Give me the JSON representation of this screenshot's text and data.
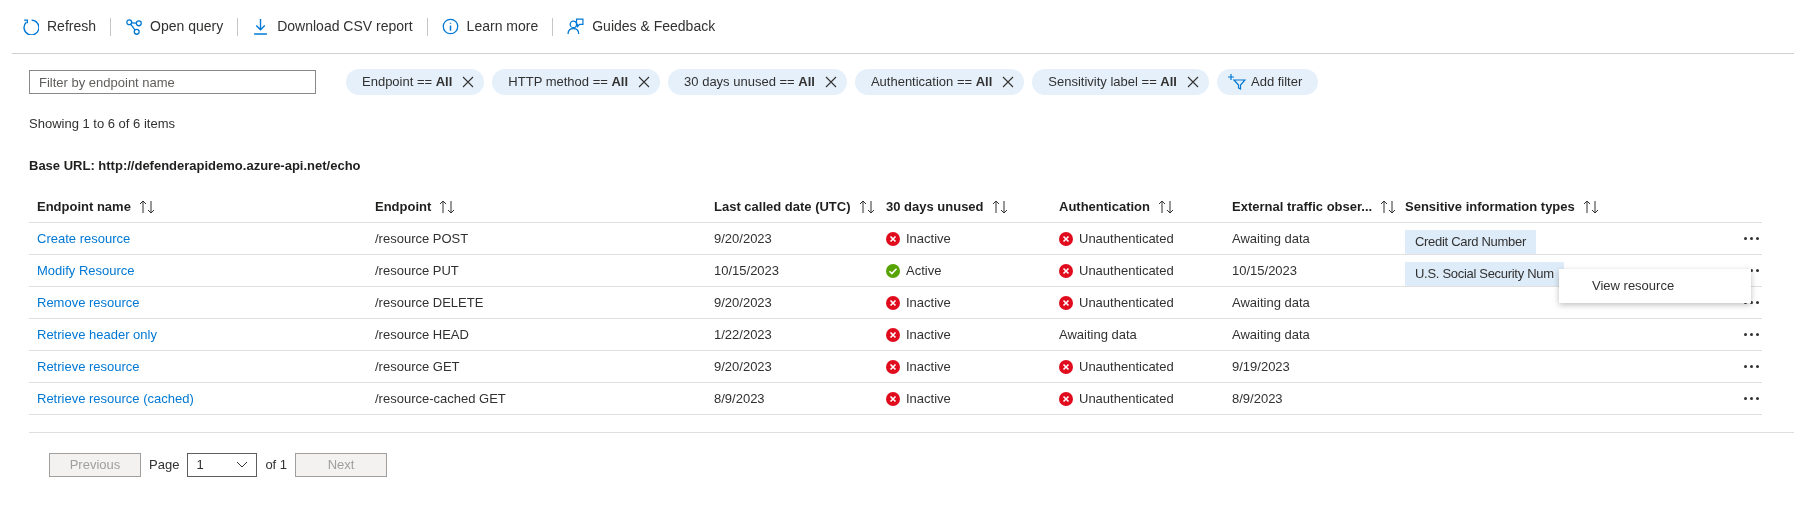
{
  "toolbar": [
    {
      "kind": "refresh",
      "label": "Refresh"
    },
    {
      "kind": "query",
      "label": "Open query"
    },
    {
      "kind": "download",
      "label": "Download CSV report"
    },
    {
      "kind": "info",
      "label": "Learn more"
    },
    {
      "kind": "feedback",
      "label": "Guides & Feedback"
    }
  ],
  "search": {
    "placeholder": "Filter by endpoint name"
  },
  "filters": [
    {
      "label": "Endpoint == **All**"
    },
    {
      "label": "HTTP method == **All**"
    },
    {
      "label": "30 days unused == **All**"
    },
    {
      "label": "Authentication == **All**"
    },
    {
      "label": "Sensitivity label == **All**"
    }
  ],
  "add_filter": "Add filter",
  "summary": "Showing 1 to 6 of 6 items",
  "base_url": "Base URL: http://defenderapidemo.azure-api.net/echo",
  "table": {
    "columns": [
      "Endpoint name",
      "Endpoint",
      "Last called date (UTC)",
      "30 days unused",
      "Authentication",
      "External traffic obser...",
      "Sensitive information types"
    ],
    "rows": [
      {
        "name": "Create resource",
        "endpoint": "/resource POST",
        "last_called": "9/20/2023",
        "unused": {
          "kind": "inactive",
          "text": "Inactive"
        },
        "auth": {
          "kind": "unauthenticated",
          "text": "Unauthenticated"
        },
        "external": "Awaiting data",
        "sensitive": [
          "Credit Card Number"
        ]
      },
      {
        "name": "Modify Resource",
        "endpoint": "/resource PUT",
        "last_called": "10/15/2023",
        "unused": {
          "kind": "active",
          "text": "Active"
        },
        "auth": {
          "kind": "unauthenticated",
          "text": "Unauthenticated"
        },
        "external": "10/15/2023",
        "sensitive": [
          "U.S. Social Security Num"
        ],
        "menu_open": true
      },
      {
        "name": "Remove resource",
        "endpoint": "/resource DELETE",
        "last_called": "9/20/2023",
        "unused": {
          "kind": "inactive",
          "text": "Inactive"
        },
        "auth": {
          "kind": "unauthenticated",
          "text": "Unauthenticated"
        },
        "external": "Awaiting data"
      },
      {
        "name": "Retrieve header only",
        "endpoint": "/resource HEAD",
        "last_called": "1/22/2023",
        "unused": {
          "kind": "inactive",
          "text": "Inactive"
        },
        "auth": {
          "kind": "plain",
          "text": "Awaiting data"
        },
        "external": "Awaiting data"
      },
      {
        "name": "Retrieve resource",
        "endpoint": "/resource GET",
        "last_called": "9/20/2023",
        "unused": {
          "kind": "inactive",
          "text": "Inactive"
        },
        "auth": {
          "kind": "unauthenticated",
          "text": "Unauthenticated"
        },
        "external": "9/19/2023"
      },
      {
        "name": "Retrieve resource (cached)",
        "endpoint": "/resource-cached GET",
        "last_called": "8/9/2023",
        "unused": {
          "kind": "inactive",
          "text": "Inactive"
        },
        "auth": {
          "kind": "unauthenticated",
          "text": "Unauthenticated"
        },
        "external": "8/9/2023"
      }
    ]
  },
  "context_menu": {
    "items": [
      "View resource"
    ]
  },
  "pager": {
    "previous": "Previous",
    "page_label": "Page",
    "page": "1",
    "of": "of 1",
    "next": "Next",
    "previous_disabled": true,
    "next_disabled": true
  }
}
